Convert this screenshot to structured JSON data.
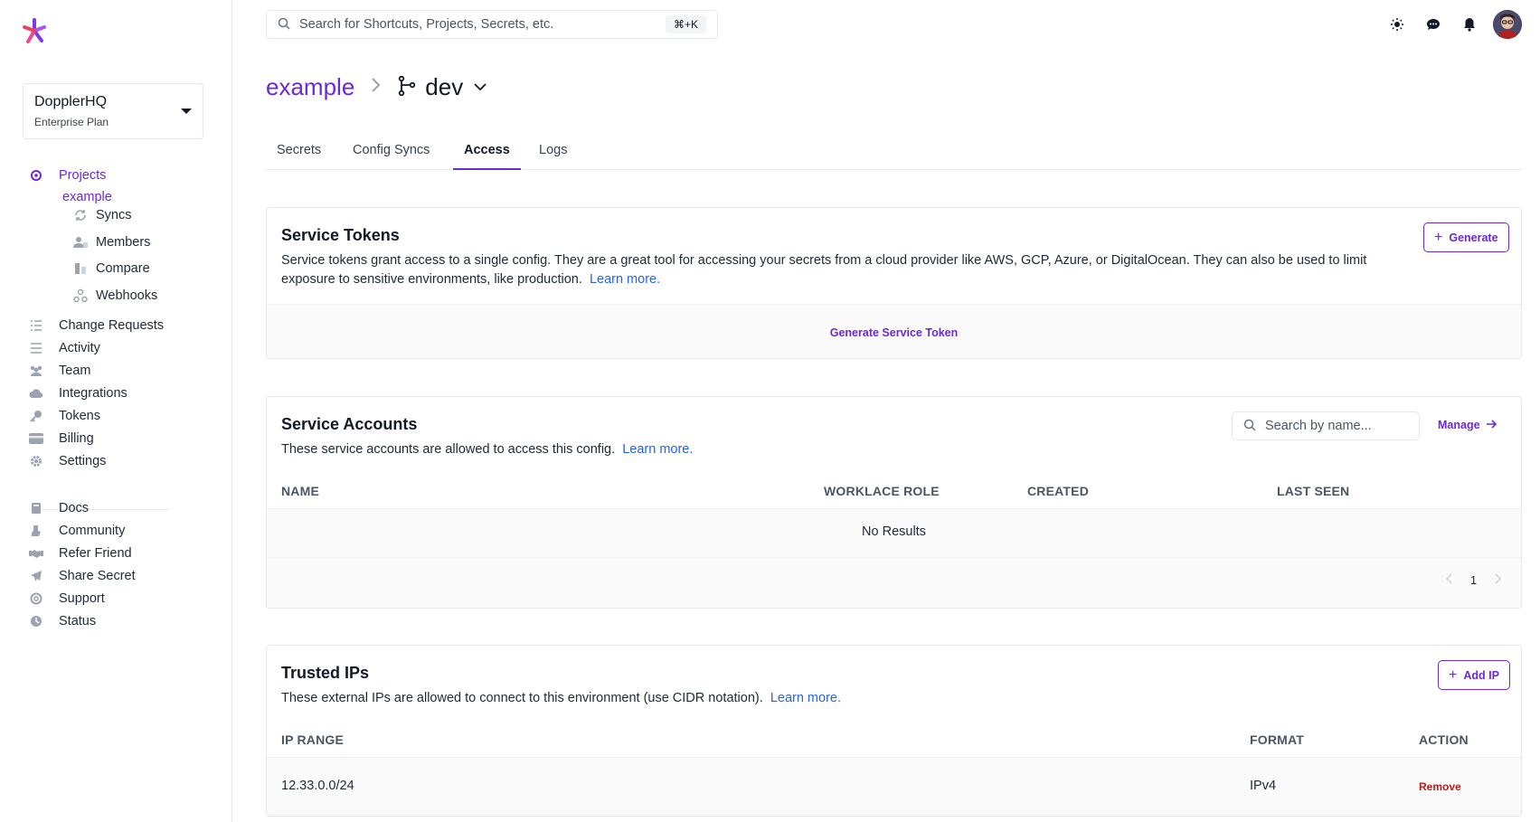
{
  "sidebar": {
    "workspace": {
      "name": "DopplerHQ",
      "plan": "Enterprise Plan"
    },
    "projects_label": "Projects",
    "project_name": "example",
    "project_items": [
      {
        "label": "Syncs",
        "icon": "sync-icon"
      },
      {
        "label": "Members",
        "icon": "members-icon"
      },
      {
        "label": "Compare",
        "icon": "compare-icon"
      },
      {
        "label": "Webhooks",
        "icon": "webhook-icon"
      }
    ],
    "main_items": [
      {
        "label": "Change Requests",
        "icon": "checklist-icon"
      },
      {
        "label": "Activity",
        "icon": "list-icon"
      },
      {
        "label": "Team",
        "icon": "team-icon"
      },
      {
        "label": "Integrations",
        "icon": "cloud-icon"
      },
      {
        "label": "Tokens",
        "icon": "key-icon"
      },
      {
        "label": "Billing",
        "icon": "credit-card-icon"
      },
      {
        "label": "Settings",
        "icon": "gear-icon"
      }
    ],
    "footer_items": [
      {
        "label": "Docs",
        "icon": "book-icon"
      },
      {
        "label": "Community",
        "icon": "community-icon"
      },
      {
        "label": "Refer Friend",
        "icon": "handshake-icon"
      },
      {
        "label": "Share Secret",
        "icon": "paper-plane-icon"
      },
      {
        "label": "Support",
        "icon": "lifebuoy-icon"
      },
      {
        "label": "Status",
        "icon": "clock-icon"
      }
    ]
  },
  "topbar": {
    "search_placeholder": "Search for Shortcuts, Projects, Secrets, etc.",
    "shortcut": "⌘+K"
  },
  "header": {
    "project": "example",
    "environment": "dev"
  },
  "tabs": [
    {
      "label": "Secrets"
    },
    {
      "label": "Config Syncs"
    },
    {
      "label": "Access"
    },
    {
      "label": "Logs"
    }
  ],
  "service_tokens": {
    "title": "Service Tokens",
    "description": "Service tokens grant access to a single config. They are a great tool for accessing your secrets from a cloud provider like AWS, GCP, Azure, or DigitalOcean. They can also be used to limit exposure to sensitive environments, like production.",
    "learn_more": "Learn more.",
    "generate_button": "Generate",
    "empty_action": "Generate Service Token"
  },
  "service_accounts": {
    "title": "Service Accounts",
    "description": "These service accounts are allowed to access this config.",
    "learn_more": "Learn more.",
    "search_placeholder": "Search by name...",
    "manage": "Manage",
    "columns": {
      "name": "NAME",
      "role": "WORKLACE ROLE",
      "created": "CREATED",
      "last_seen": "LAST SEEN"
    },
    "empty": "No Results",
    "page": "1"
  },
  "trusted_ips": {
    "title": "Trusted IPs",
    "description": "These external IPs are allowed to connect to this environment (use CIDR notation).",
    "learn_more": "Learn more.",
    "add_button": "Add IP",
    "columns": {
      "range": "IP RANGE",
      "format": "FORMAT",
      "action": "ACTION"
    },
    "rows": [
      {
        "range": "12.33.0.0/24",
        "format": "IPv4",
        "action": "Remove"
      }
    ]
  },
  "colors": {
    "accent": "#6d28d9",
    "link": "#2563eb",
    "danger": "#b91c1c"
  }
}
